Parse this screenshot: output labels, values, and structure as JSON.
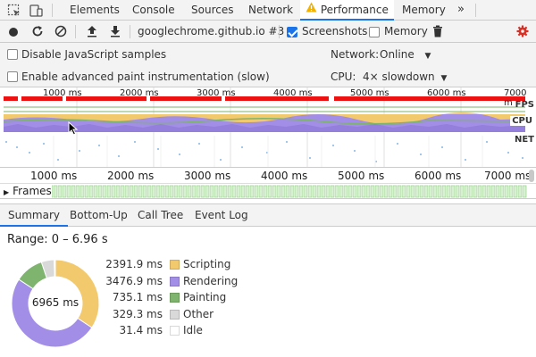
{
  "tabs": [
    {
      "label": "Elements"
    },
    {
      "label": "Console"
    },
    {
      "label": "Sources"
    },
    {
      "label": "Network"
    },
    {
      "label": "Performance"
    },
    {
      "label": "Memory"
    }
  ],
  "tabs_more": "»",
  "toolbar": {
    "recording_select": "googlechrome.github.io #3",
    "screenshots_label": "Screenshots",
    "screenshots_checked": true,
    "memory_label": "Memory",
    "memory_checked": false
  },
  "settings": {
    "disable_js_label": "Disable JavaScript samples",
    "paint_label": "Enable advanced paint instrumentation (slow)",
    "network_label": "Network:",
    "network_value": "Online",
    "cpu_label": "CPU:",
    "cpu_value": "4× slowdown"
  },
  "overview": {
    "ruler": [
      "1000 ms",
      "2000 ms",
      "3000 ms",
      "4000 ms",
      "5000 ms",
      "6000 ms",
      "7000 m"
    ],
    "lanes": {
      "fps": "FPS",
      "cpu": "CPU",
      "net": "NET"
    }
  },
  "timeline_ruler": [
    "1000 ms",
    "2000 ms",
    "3000 ms",
    "4000 ms",
    "5000 ms",
    "6000 ms",
    "7000 ms"
  ],
  "frames_label": "Frames",
  "panel_tabs": [
    {
      "label": "Summary"
    },
    {
      "label": "Bottom-Up"
    },
    {
      "label": "Call Tree"
    },
    {
      "label": "Event Log"
    }
  ],
  "summary": {
    "range": "Range: 0 – 6.96 s",
    "total": "6965 ms",
    "items": [
      {
        "value": "2391.9 ms",
        "label": "Scripting",
        "ms": 2391.9,
        "color": "#f2c96d"
      },
      {
        "value": "3476.9 ms",
        "label": "Rendering",
        "ms": 3476.9,
        "color": "#a28ee6"
      },
      {
        "value": "735.1 ms",
        "label": "Painting",
        "ms": 735.1,
        "color": "#7eb46d"
      },
      {
        "value": "329.3 ms",
        "label": "Other",
        "ms": 329.3,
        "color": "#d9d9d9"
      },
      {
        "value": "31.4 ms",
        "label": "Idle",
        "ms": 31.4,
        "color": "#ffffff"
      }
    ]
  }
}
